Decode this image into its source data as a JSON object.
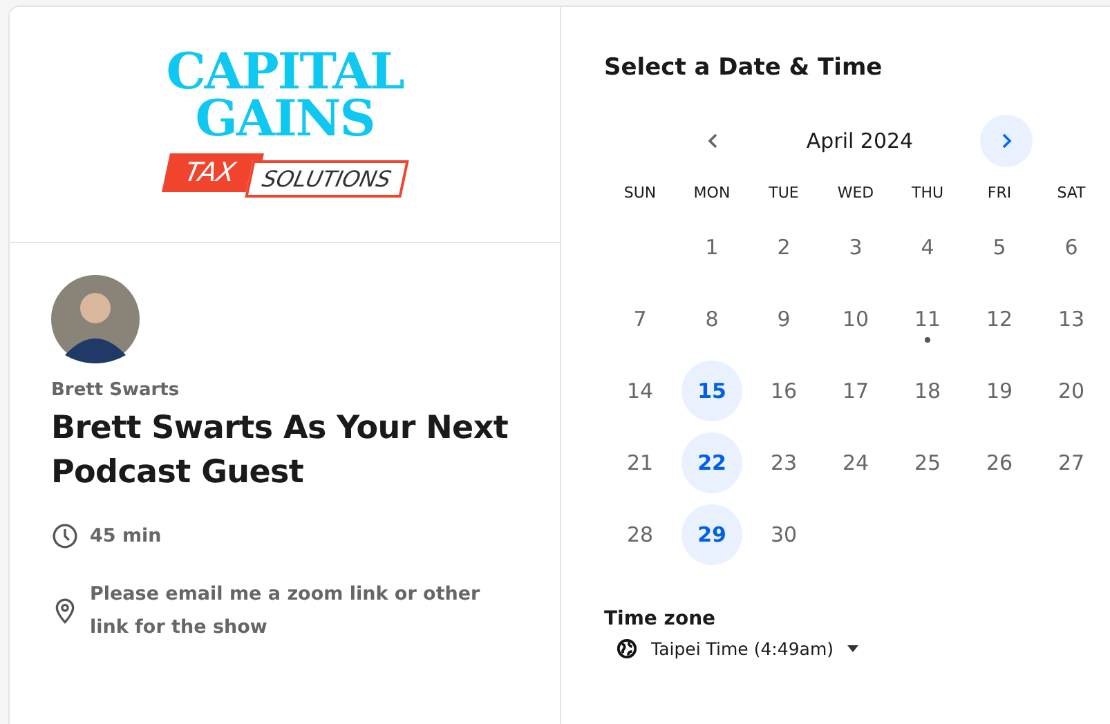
{
  "logo": {
    "line_1": "CAPITAL",
    "line_2": "GAINS",
    "tag_left": "TAX",
    "tag_right": "SOLUTIONS"
  },
  "host": {
    "name": "Brett Swarts"
  },
  "event": {
    "title": "Brett Swarts As Your Next Podcast Guest",
    "details": [
      {
        "kind": "duration",
        "text": "45 min"
      },
      {
        "kind": "location",
        "text": "Please email me a zoom link or other link for the show"
      }
    ]
  },
  "calendar": {
    "heading": "Select a Date & Time",
    "month": "April 2024",
    "prev_disabled": true,
    "next_disabled": false,
    "weekdays": [
      "SUN",
      "MON",
      "TUE",
      "WED",
      "THU",
      "FRI",
      "SAT"
    ],
    "weeks": [
      [
        {
          "day": "1",
          "available": false,
          "today": false
        },
        {
          "day": "2",
          "available": false,
          "today": false
        },
        {
          "day": "3",
          "available": false,
          "today": false
        },
        {
          "day": "4",
          "available": false,
          "today": false
        },
        {
          "day": "5",
          "available": false,
          "today": false
        },
        {
          "day": "6",
          "available": false,
          "today": false
        }
      ],
      [
        {
          "day": "7",
          "available": false,
          "today": false
        },
        {
          "day": "8",
          "available": false,
          "today": false
        },
        {
          "day": "9",
          "available": false,
          "today": false
        },
        {
          "day": "10",
          "available": false,
          "today": false
        },
        {
          "day": "11",
          "available": false,
          "today": true
        },
        {
          "day": "12",
          "available": false,
          "today": false
        },
        {
          "day": "13",
          "available": false,
          "today": false
        }
      ],
      [
        {
          "day": "14",
          "available": false,
          "today": false
        },
        {
          "day": "15",
          "available": true,
          "today": false
        },
        {
          "day": "16",
          "available": false,
          "today": false
        },
        {
          "day": "17",
          "available": false,
          "today": false
        },
        {
          "day": "18",
          "available": false,
          "today": false
        },
        {
          "day": "19",
          "available": false,
          "today": false
        },
        {
          "day": "20",
          "available": false,
          "today": false
        }
      ],
      [
        {
          "day": "21",
          "available": false,
          "today": false
        },
        {
          "day": "22",
          "available": true,
          "today": false
        },
        {
          "day": "23",
          "available": false,
          "today": false
        },
        {
          "day": "24",
          "available": false,
          "today": false
        },
        {
          "day": "25",
          "available": false,
          "today": false
        },
        {
          "day": "26",
          "available": false,
          "today": false
        },
        {
          "day": "27",
          "available": false,
          "today": false
        }
      ],
      [
        {
          "day": "28",
          "available": false,
          "today": false
        },
        {
          "day": "29",
          "available": true,
          "today": false
        },
        {
          "day": "30",
          "available": false,
          "today": false
        }
      ]
    ]
  },
  "time_zone": {
    "label": "Time zone",
    "value": "Taipei Time (4:49am)"
  }
}
